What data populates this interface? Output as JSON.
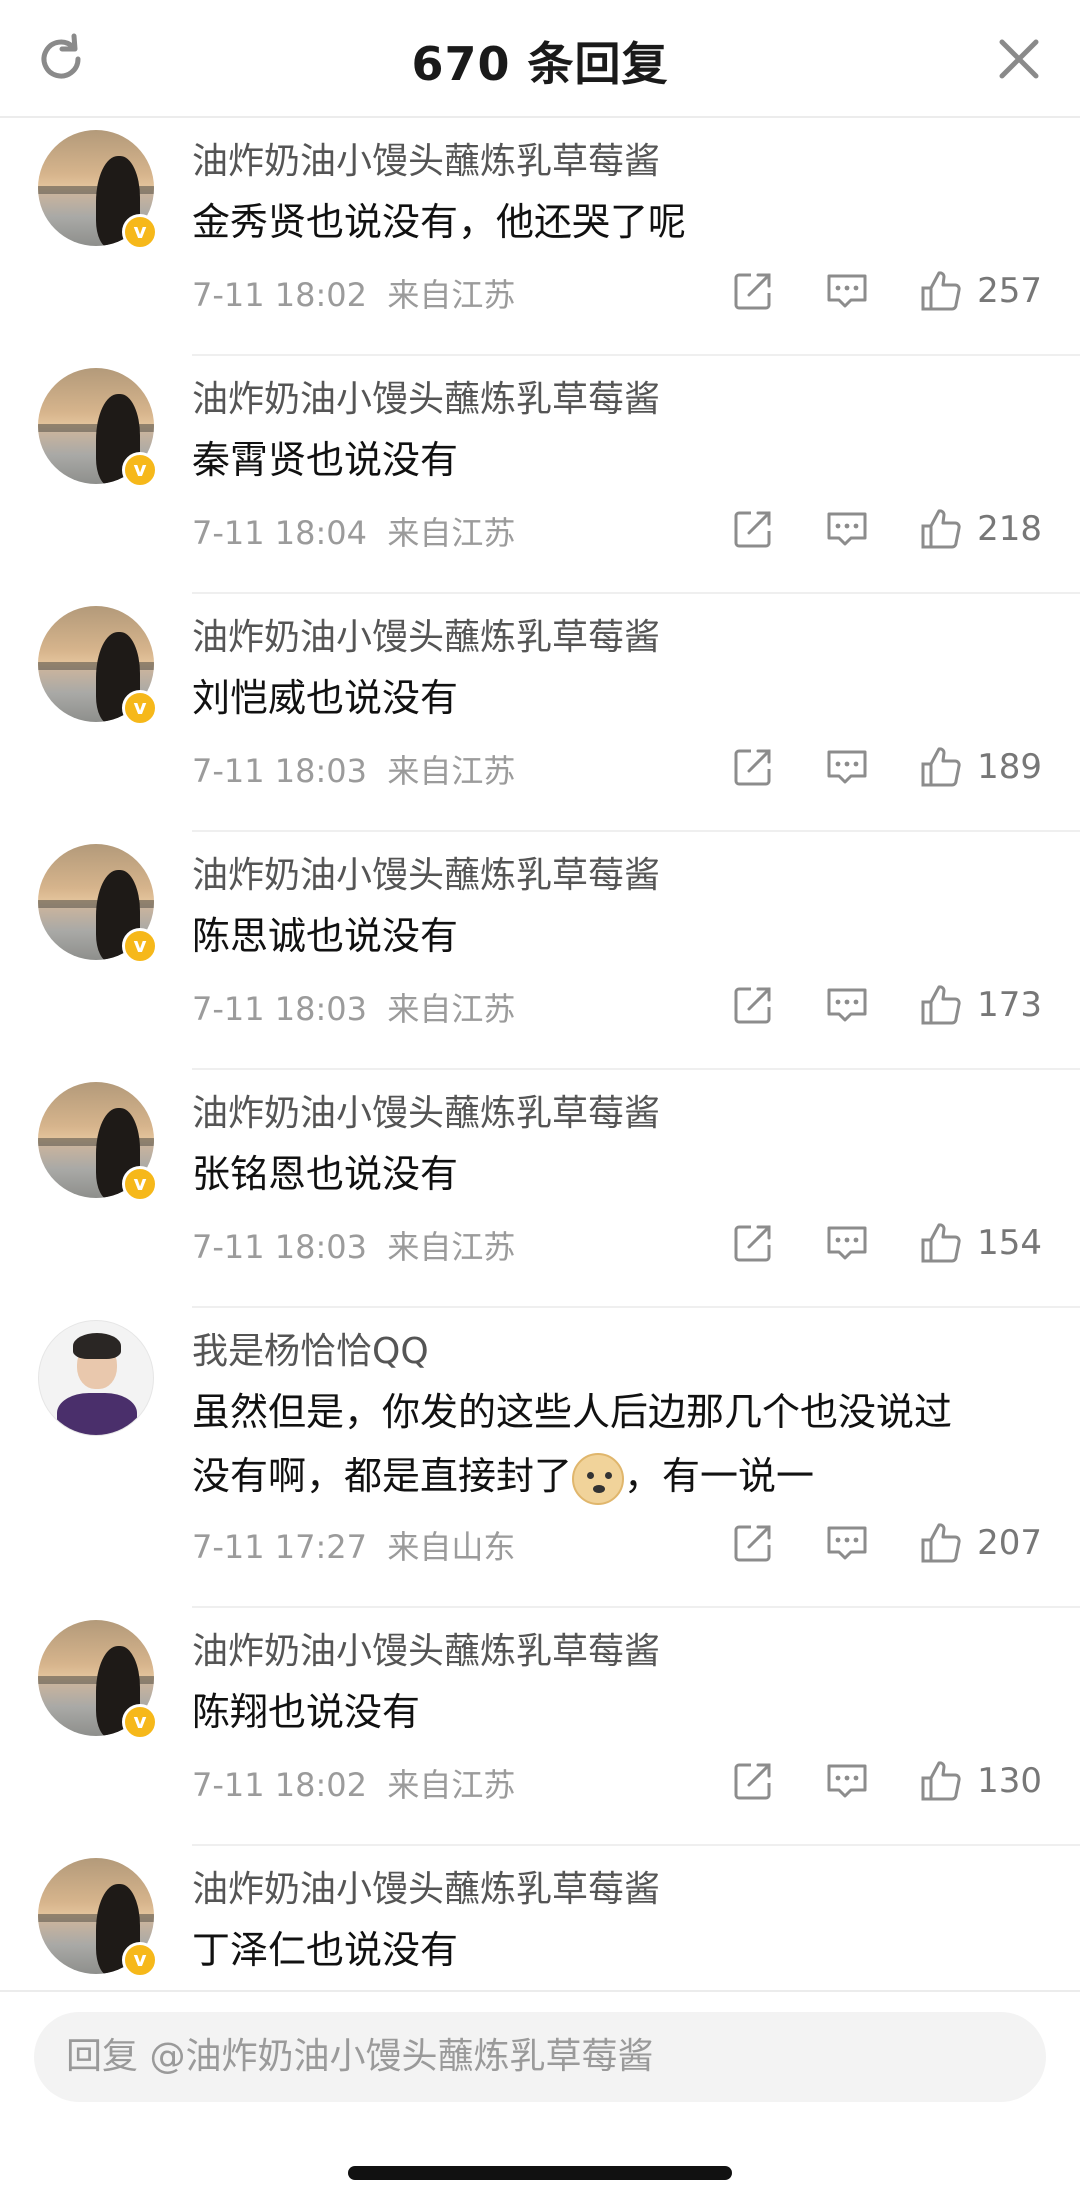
{
  "header": {
    "title": "670 条回复",
    "refresh_icon": "refresh-icon",
    "close_icon": "close-icon"
  },
  "comments": [
    {
      "username": "油炸奶油小馒头蘸炼乳草莓酱",
      "text": "金秀贤也说没有，他还哭了呢",
      "time": "7-11 18:02",
      "location": "来自江苏",
      "likes": "257",
      "avatar": "sunset",
      "verified": true
    },
    {
      "username": "油炸奶油小馒头蘸炼乳草莓酱",
      "text": "秦霄贤也说没有",
      "time": "7-11 18:04",
      "location": "来自江苏",
      "likes": "218",
      "avatar": "sunset",
      "verified": true
    },
    {
      "username": "油炸奶油小馒头蘸炼乳草莓酱",
      "text": "刘恺威也说没有",
      "time": "7-11 18:03",
      "location": "来自江苏",
      "likes": "189",
      "avatar": "sunset",
      "verified": true
    },
    {
      "username": "油炸奶油小馒头蘸炼乳草莓酱",
      "text": "陈思诚也说没有",
      "time": "7-11 18:03",
      "location": "来自江苏",
      "likes": "173",
      "avatar": "sunset",
      "verified": true
    },
    {
      "username": "油炸奶油小馒头蘸炼乳草莓酱",
      "text": "张铭恩也说没有",
      "time": "7-11 18:03",
      "location": "来自江苏",
      "likes": "154",
      "avatar": "sunset",
      "verified": true
    },
    {
      "username": "我是杨恰恰QQ",
      "text_line1": "虽然但是，你发的这些人后边那几个也没说过",
      "text_line2_a": "没有啊，都是直接封了",
      "text_line2_b": "，有一说一",
      "emoji": "doge-emoji",
      "time": "7-11 17:27",
      "location": "来自山东",
      "likes": "207",
      "avatar": "person",
      "verified": false
    },
    {
      "username": "油炸奶油小馒头蘸炼乳草莓酱",
      "text": "陈翔也说没有",
      "time": "7-11 18:02",
      "location": "来自江苏",
      "likes": "130",
      "avatar": "sunset",
      "verified": true
    },
    {
      "username": "油炸奶油小馒头蘸炼乳草莓酱",
      "text": "丁泽仁也说没有",
      "avatar": "sunset",
      "verified": true
    }
  ],
  "icons": {
    "share": "share-icon",
    "reply": "comment-icon",
    "like": "thumbs-up-icon",
    "verified": "verified-badge-icon"
  },
  "verified_badge_text": "v",
  "footer": {
    "reply_placeholder": "回复 @油炸奶油小馒头蘸炼乳草莓酱"
  },
  "colors": {
    "verified_badge": "#f6b81a",
    "meta_text": "#9b9b9b",
    "reply_box_bg": "#f3f3f3"
  }
}
